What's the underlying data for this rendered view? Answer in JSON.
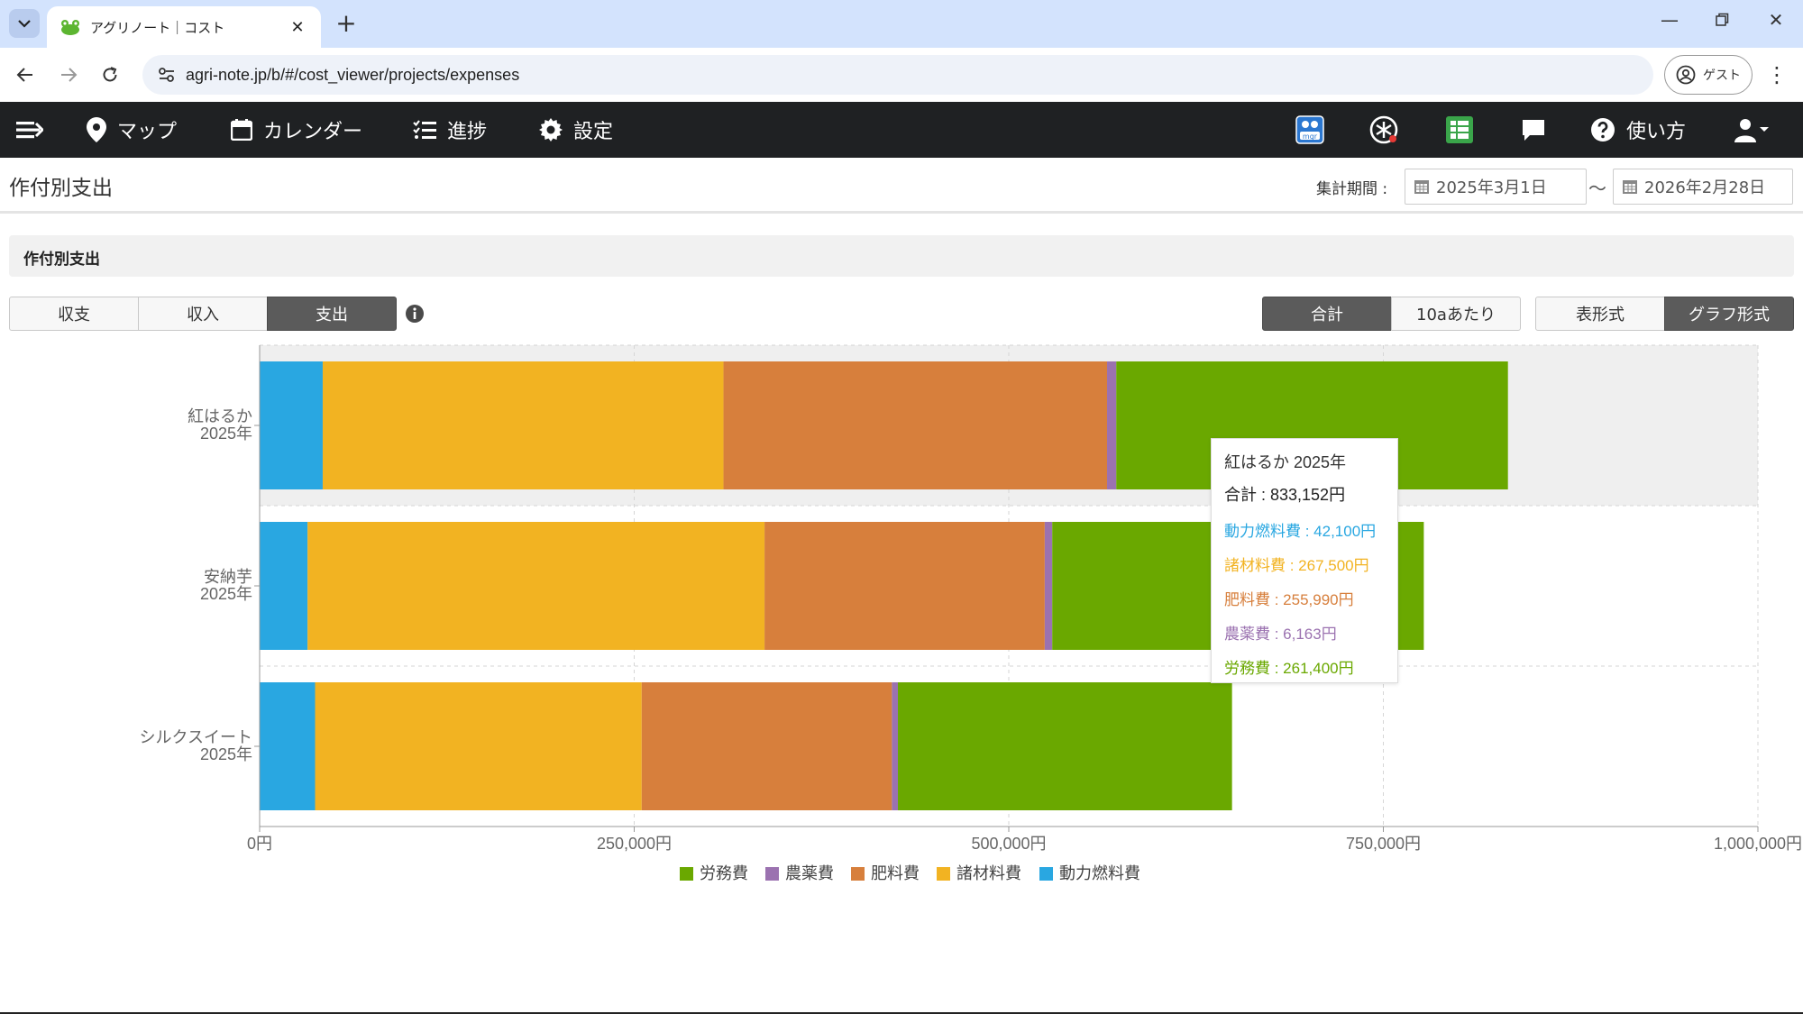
{
  "browser": {
    "tab_title": "アグリノート｜コスト",
    "url": "agri-note.jp/b/#/cost_viewer/projects/expenses",
    "guest_label": "ゲスト"
  },
  "appnav": {
    "map": "マップ",
    "calendar": "カレンダー",
    "progress": "進捗",
    "settings": "設定",
    "help": "使い方"
  },
  "header": {
    "title": "作付別支出",
    "period_label": "集計期間 :",
    "start_date": "2025年3月1日",
    "tilde": "〜",
    "end_date": "2026年2月28日"
  },
  "section": {
    "title": "作付別支出",
    "mode_tabs": [
      "収支",
      "収入",
      "支出"
    ],
    "active_mode": 2,
    "unit_tabs": [
      "合計",
      "10aあたり"
    ],
    "active_unit": 0,
    "view_tabs": [
      "表形式",
      "グラフ形式"
    ],
    "active_view": 1
  },
  "colors": {
    "labor": "#6aa800",
    "pesticide": "#9b72b0",
    "fertilizer": "#d77f3c",
    "materials": "#f2b322",
    "fuel": "#29a7e1"
  },
  "chart_data": {
    "type": "bar",
    "orientation": "horizontal",
    "stacked": true,
    "categories": [
      "紅はるか\n2025年",
      "安納芋\n2025年",
      "シルクスイート\n2025年"
    ],
    "series": [
      {
        "name": "動力燃料費",
        "color": "#29a7e1",
        "values": [
          42100,
          32000,
          37000
        ]
      },
      {
        "name": "諸材料費",
        "color": "#f2b322",
        "values": [
          267500,
          305000,
          218000
        ]
      },
      {
        "name": "肥料費",
        "color": "#d77f3c",
        "values": [
          255990,
          187000,
          167000
        ]
      },
      {
        "name": "農薬費",
        "color": "#9b72b0",
        "values": [
          6163,
          5000,
          4000
        ]
      },
      {
        "name": "労務費",
        "color": "#6aa800",
        "values": [
          261400,
          248000,
          223000
        ]
      }
    ],
    "xlim": [
      0,
      1000000
    ],
    "x_ticks": [
      "0円",
      "250,000円",
      "500,000円",
      "750,000円",
      "1,000,000円"
    ],
    "legend": [
      "労務費",
      "農薬費",
      "肥料費",
      "諸材料費",
      "動力燃料費"
    ],
    "legend_position": "bottom",
    "grid": true,
    "highlighted_category": 0,
    "tooltip": {
      "title": "紅はるか 2025年",
      "total": "合計 : 833,152円",
      "rows": [
        {
          "text": "動力燃料費 : 42,100円",
          "color": "#29a7e1"
        },
        {
          "text": "諸材料費 : 267,500円",
          "color": "#f2b322"
        },
        {
          "text": "肥料費 : 255,990円",
          "color": "#d77f3c"
        },
        {
          "text": "農薬費 : 6,163円",
          "color": "#9b72b0"
        },
        {
          "text": "労務費 : 261,400円",
          "color": "#6aa800"
        }
      ]
    }
  }
}
